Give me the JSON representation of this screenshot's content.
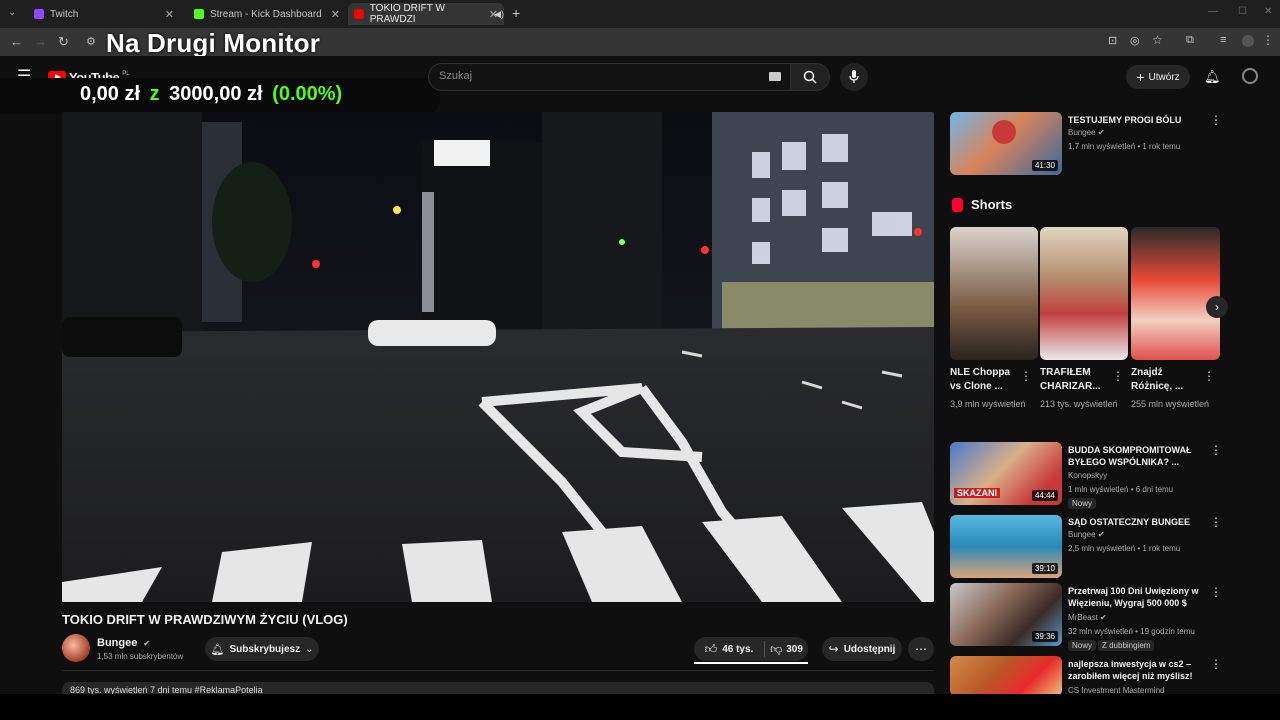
{
  "tabs": [
    {
      "label": "Twitch",
      "color": "#9146ff"
    },
    {
      "label": "Stream - Kick Dashboard",
      "color": "#53fc18"
    },
    {
      "label": "TOKIO DRIFT W PRAWDZI",
      "color": "#ff0000"
    }
  ],
  "overlay": {
    "title": "Na Drugi Monitor",
    "amount": "0,00 zł",
    "separator": "z",
    "goal": "3000,00 zł",
    "percent": "(0.00%)"
  },
  "youtube": {
    "logo_text": "YouTube",
    "logo_region": "PL",
    "search_placeholder": "Szukaj",
    "create_label": "Utwórz"
  },
  "video": {
    "title": "TOKIO DRIFT W PRAWDZIWYM ŻYCIU (VLOG)",
    "channel": "Bungee",
    "subscribers": "1,53 mln subskrybentów",
    "subscribe_label": "Subskrybujesz",
    "likes": "46 tys.",
    "dislikes": "309",
    "share_label": "Udostępnij",
    "description_line": "869 tys. wyświetleń  7 dni temu  #ReklamaPotelia"
  },
  "sidebar": {
    "top_video": {
      "title": "TESTUJEMY PROGI BÓLU",
      "channel": "Bungee",
      "meta": "1,7 mln wyświetleń • 1 rok temu",
      "duration": "41:30"
    },
    "shorts_label": "Shorts",
    "shorts": [
      {
        "title": "NLE Choppa vs Clone ...",
        "views": "3,9 mln wyświetleń"
      },
      {
        "title": "TRAFIŁEM CHARIZAR...",
        "views": "213 tys. wyświetleń"
      },
      {
        "title": "Znajdź Różnicę, ...",
        "views": "255 mln wyświetleń"
      }
    ],
    "videos": [
      {
        "title": "BUDDA SKOMPROMITOWAŁ BYŁEGO WSPÓLNIKA? ...",
        "channel": "Konopskyy",
        "meta": "1 mln wyświetleń • 6 dni temu",
        "duration": "44:44",
        "badge": "Nowy"
      },
      {
        "title": "SĄD OSTATECZNY BUNGEE",
        "channel": "Bungee",
        "meta": "2,5 mln wyświetleń • 1 rok temu",
        "duration": "39:10",
        "badge": ""
      },
      {
        "title": "Przetrwaj 100 Dni Uwięziony w Więzieniu, Wygraj 500 000 $",
        "channel": "MrBeast",
        "meta": "32 mln wyświetleń • 19 godzin temu",
        "duration": "39:36",
        "badge": "Nowy",
        "badge2": "Z dubbingiem"
      },
      {
        "title": "najlepsza inwestycja w cs2 – zarobiłem więcej niż myślisz!",
        "channel": "CS Investment Mastermind",
        "meta": "",
        "duration": "",
        "badge": ""
      }
    ]
  }
}
